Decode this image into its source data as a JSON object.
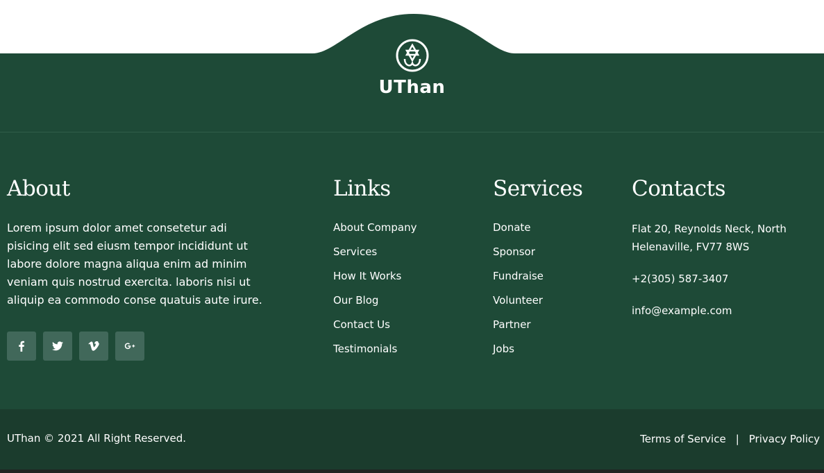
{
  "brand": {
    "name": "UThan",
    "logo_icon": "star-of-david-icon"
  },
  "about": {
    "heading": "About",
    "text": "Lorem ipsum dolor amet consetetur adi pisicing elit sed eiusm tempor incididunt ut labore dolore magna aliqua enim ad minim veniam quis nostrud exercita. laboris nisi ut aliquip ea commodo conse quatuis aute irure.",
    "socials": [
      {
        "icon": "facebook-icon"
      },
      {
        "icon": "twitter-icon"
      },
      {
        "icon": "vimeo-icon"
      },
      {
        "icon": "google-plus-icon"
      }
    ]
  },
  "links": {
    "heading": "Links",
    "items": [
      "About Company",
      "Services",
      "How It Works",
      "Our Blog",
      "Contact Us",
      "Testimonials"
    ]
  },
  "services": {
    "heading": "Services",
    "items": [
      "Donate",
      "Sponsor",
      "Fundraise",
      "Volunteer",
      "Partner",
      "Jobs"
    ]
  },
  "contacts": {
    "heading": "Contacts",
    "address": "Flat 20, Reynolds Neck, North Helenaville, FV77 8WS",
    "phone": "+2(305) 587-3407",
    "email": "info@example.com"
  },
  "bottom": {
    "copyright": "UThan © 2021 All Right Reserved.",
    "terms": "Terms of Service",
    "separator": "|",
    "privacy": "Privacy Policy"
  },
  "colors": {
    "footer_bg": "#1e4a37",
    "bottom_bg": "#1b3c2d",
    "social_bg": "#41685a",
    "text": "#ffffff"
  }
}
